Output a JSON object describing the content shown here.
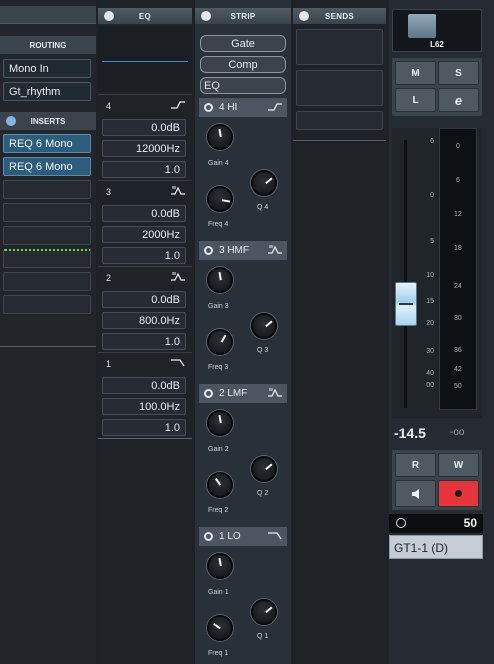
{
  "routing": {
    "header": "ROUTING",
    "input": "Mono In",
    "output": "Gt_rhythm"
  },
  "inserts": {
    "header": "INSERTS",
    "slots": [
      "REQ 6 Mono",
      "REQ 6 Mono",
      "",
      "",
      "",
      "",
      "",
      ""
    ]
  },
  "eq": {
    "header": "EQ",
    "bands": [
      {
        "num": "4",
        "shape": "high-shelf-icon",
        "gain": "0.0dB",
        "freq": "12000Hz",
        "q": "1.0"
      },
      {
        "num": "3",
        "shape": "peak-icon",
        "gain": "0.0dB",
        "freq": "2000Hz",
        "q": "1.0"
      },
      {
        "num": "2",
        "shape": "peak-icon",
        "gain": "0.0dB",
        "freq": "800.0Hz",
        "q": "1.0"
      },
      {
        "num": "1",
        "shape": "low-cut-icon",
        "gain": "0.0dB",
        "freq": "100.0Hz",
        "q": "1.0"
      }
    ]
  },
  "strip": {
    "header": "STRIP",
    "modules": [
      "Gate",
      "Comp",
      "EQ"
    ],
    "bands": [
      {
        "name": "4 HI",
        "gain": "Gain 4",
        "freq": "Freq 4",
        "q": "Q 4"
      },
      {
        "name": "3 HMF",
        "gain": "Gain 3",
        "freq": "Freq 3",
        "q": "Q 3"
      },
      {
        "name": "2 LMF",
        "gain": "Gain 2",
        "freq": "Freq 2",
        "q": "Q 2"
      },
      {
        "name": "1 LO",
        "gain": "Gain 1",
        "freq": "Freq 1",
        "q": "Q 1"
      }
    ]
  },
  "sends": {
    "header": "SENDS"
  },
  "fader": {
    "pan": "L62",
    "buttons": {
      "mute": "M",
      "solo": "S",
      "listen": "L",
      "edit": "e",
      "read": "R",
      "write": "W"
    },
    "fader_scale": [
      "6",
      "0",
      "5",
      "10",
      "15",
      "20",
      "30",
      "40",
      "00"
    ],
    "meter_scale": [
      "0",
      "6",
      "12",
      "18",
      "24",
      "30",
      "36",
      "42",
      "50"
    ],
    "volume": "-14.5",
    "peak": "-oo",
    "fader_level": 0.42,
    "input_value": "50",
    "track_name": "GT1-1 (D)"
  }
}
